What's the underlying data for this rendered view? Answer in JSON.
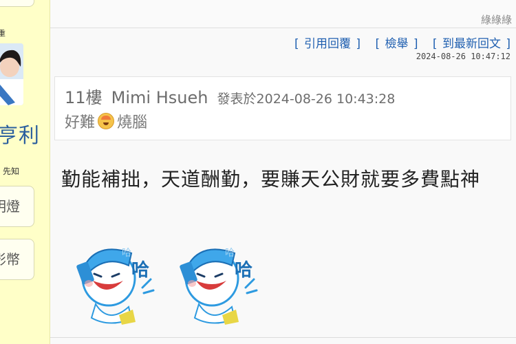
{
  "sidebar": {
    "tiny_label": "重",
    "username": "亨利",
    "small_label": "先知",
    "buttons": [
      {
        "label": "明燈"
      },
      {
        "label": "影幣"
      }
    ]
  },
  "prev_post": {
    "trailing_text": "綠綠綠",
    "top_mark": "“”"
  },
  "post": {
    "actions": [
      "[ 引用回覆 ]",
      "[ 檢舉 ]",
      "[ 到最新回文 ]"
    ],
    "timestamp": "2024-08-26 10:47:12",
    "quote": {
      "floor": "11樓",
      "author": "Mimi Hsueh",
      "posted_prefix": "發表於2024-08-26 10:43:28",
      "body_before": "好難",
      "body_after": "燒腦"
    },
    "content": "勤能補拙，天道酬勤，要賺天公財就要多費點神",
    "stickers": [
      {
        "icon": "laughing-mascot-sticker",
        "text": "哈"
      },
      {
        "icon": "laughing-mascot-sticker",
        "text": "哈"
      }
    ]
  },
  "colors": {
    "link": "#1f5fb0",
    "sidebar_bg": "#ffffc8",
    "username": "#2b5f9e"
  }
}
